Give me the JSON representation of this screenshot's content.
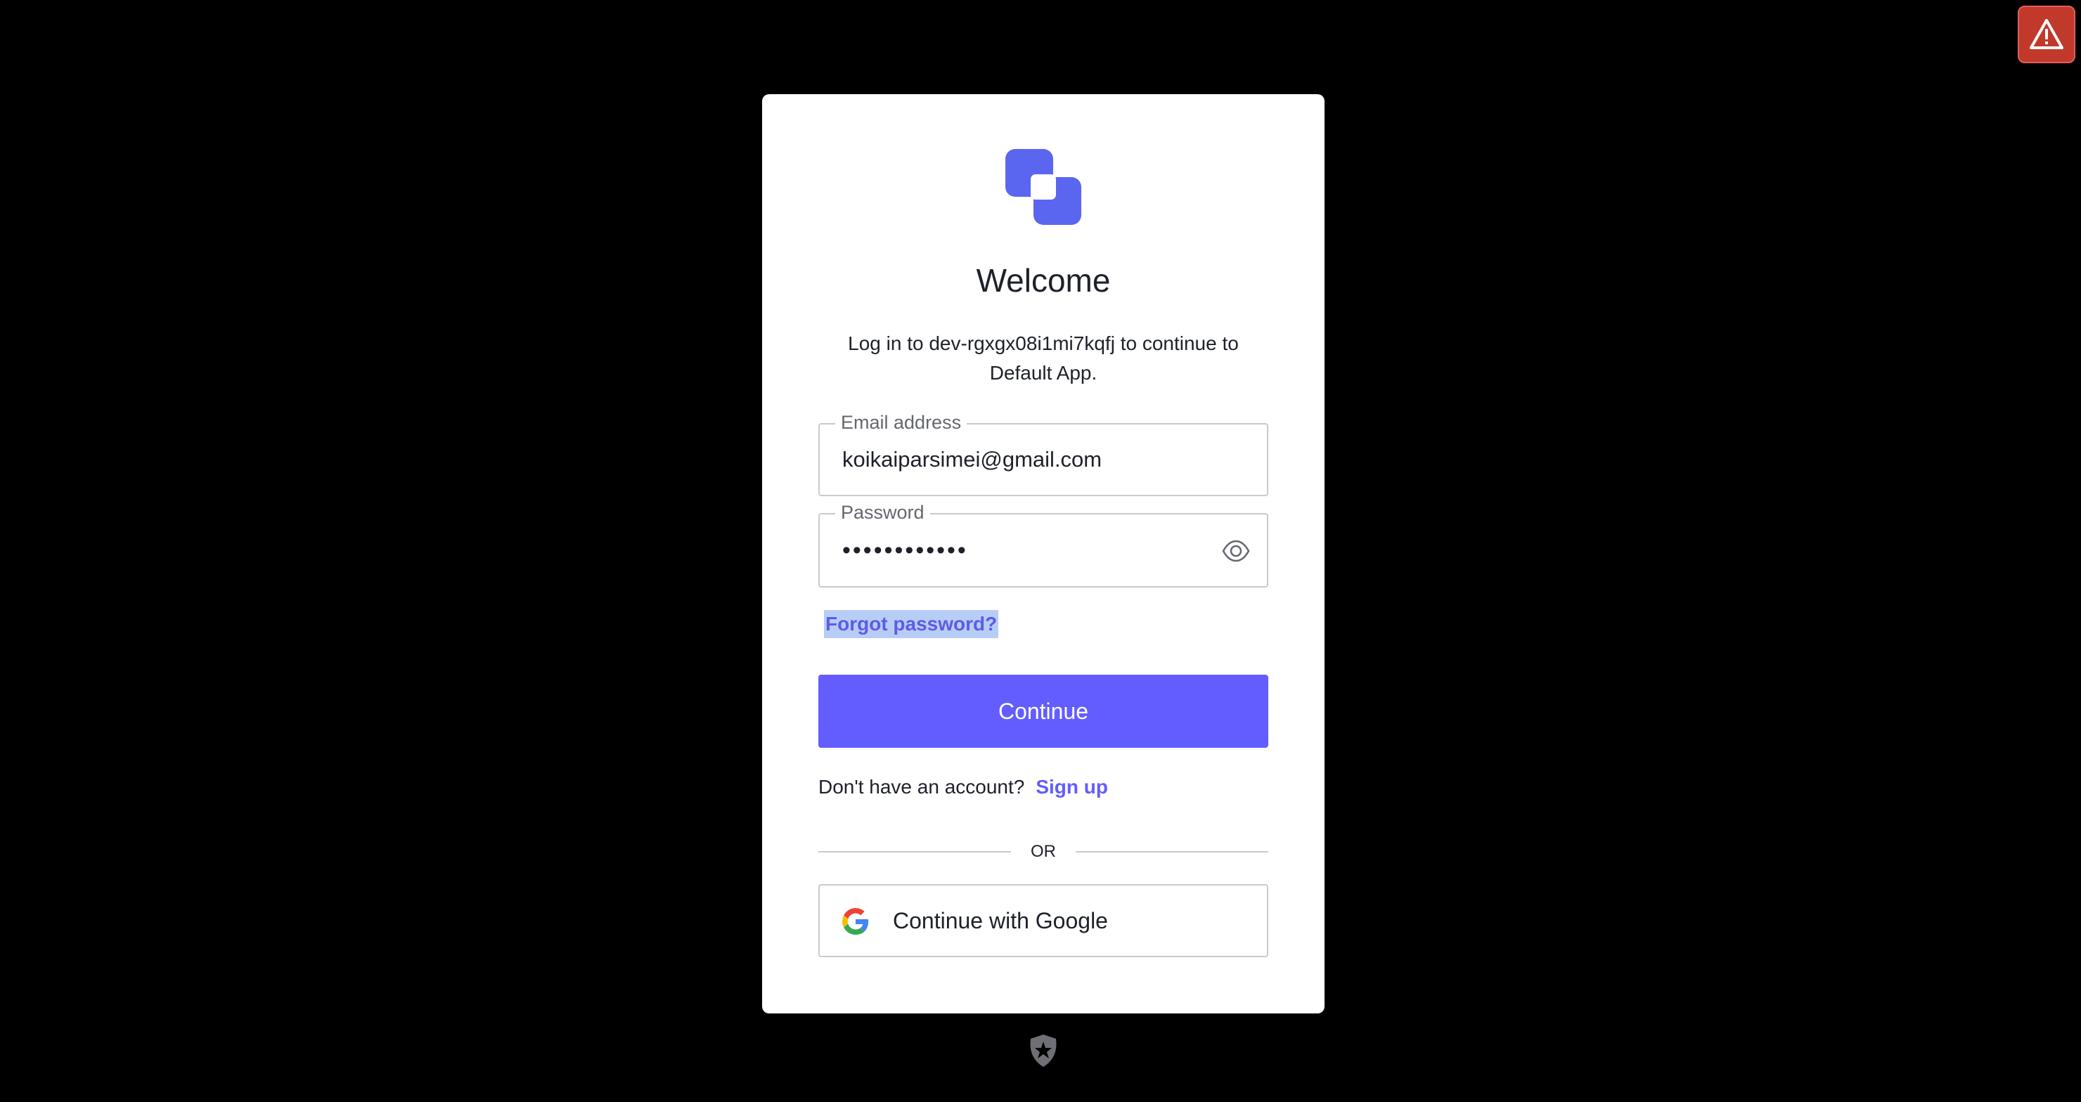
{
  "colors": {
    "background": "#000000",
    "card": "#ffffff",
    "accent": "#635dff",
    "logo_primary": "#5b66f0",
    "warning": "#c0392b"
  },
  "alert": {
    "icon": "warning-triangle-icon"
  },
  "header": {
    "logo_icon": "overlapping-squares-logo-icon",
    "title": "Welcome",
    "subtitle": "Log in to dev-rgxgx08i1mi7kqfj to continue to Default App."
  },
  "form": {
    "email": {
      "label": "Email address",
      "value": "koikaiparsimei@gmail.com"
    },
    "password": {
      "label": "Password",
      "value": "••••••••••••",
      "toggle_icon": "eye-icon"
    },
    "forgot_link": "Forgot password?",
    "continue_button": "Continue"
  },
  "signup": {
    "prompt": "Don't have an account?",
    "link": "Sign up"
  },
  "divider": {
    "text": "OR"
  },
  "social": {
    "google_label": "Continue with Google",
    "google_icon": "google-g-icon"
  },
  "footer": {
    "badge_icon": "auth0-shield-icon"
  }
}
